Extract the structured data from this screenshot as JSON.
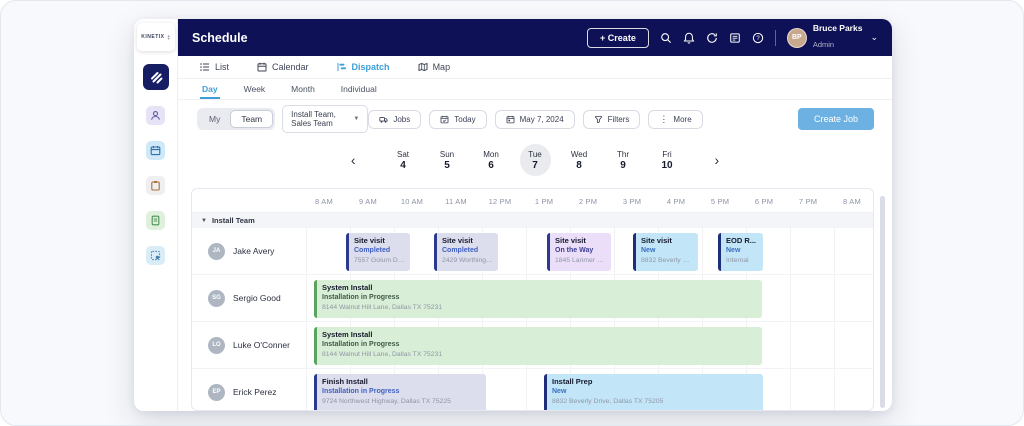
{
  "app": {
    "title": "Schedule",
    "logo": "kinetix"
  },
  "header": {
    "create": "+ Create",
    "user": {
      "name": "Bruce Parks",
      "role": "Admin",
      "initials": "BP"
    }
  },
  "tabs": {
    "list": "List",
    "calendar": "Calendar",
    "dispatch": "Dispatch",
    "map": "Map"
  },
  "subtabs": {
    "day": "Day",
    "week": "Week",
    "month": "Month",
    "individual": "Individual"
  },
  "toolbar": {
    "my": "My",
    "team": "Team",
    "team_filter": "Install Team, Sales Team",
    "jobs": "Jobs",
    "today": "Today",
    "date": "May 7, 2024",
    "filters": "Filters",
    "more": "More",
    "create_job": "Create Job"
  },
  "datenav": {
    "prev": "‹",
    "next": "›",
    "days": [
      {
        "label": "Sat",
        "num": "4"
      },
      {
        "label": "Sun",
        "num": "5"
      },
      {
        "label": "Mon",
        "num": "6"
      },
      {
        "label": "Tue",
        "num": "7"
      },
      {
        "label": "Wed",
        "num": "8"
      },
      {
        "label": "Thr",
        "num": "9"
      },
      {
        "label": "Fri",
        "num": "10"
      }
    ],
    "selected_day": "Tue 7"
  },
  "schedule": {
    "times": [
      "8 AM",
      "9 AM",
      "10 AM",
      "11 AM",
      "12 PM",
      "1 PM",
      "2 PM",
      "3 PM",
      "4 PM",
      "5 PM",
      "6 PM",
      "7 PM",
      "8 AM"
    ],
    "group": "Install Team",
    "rows": [
      {
        "name": "Jake Avery",
        "initials": "JA",
        "events": [
          {
            "title": "Site visit",
            "status": "Completed",
            "detail": "7557 Golum Dri..."
          },
          {
            "title": "Site visit",
            "status": "Completed",
            "detail": "2429 Worthingto..."
          },
          {
            "title": "Site visit",
            "status": "On the Way",
            "detail": "1845 Larimer Ro..."
          },
          {
            "title": "Site visit",
            "status": "New",
            "detail": "8832 Beverly Dri..."
          },
          {
            "title": "EOD R...",
            "status": "New",
            "detail": "Internal"
          }
        ]
      },
      {
        "name": "Sergio Good",
        "initials": "SG",
        "events": [
          {
            "title": "System Install",
            "status": "Installation in Progress",
            "detail": "8144 Walnut Hill Lane, Dallas TX 75231"
          }
        ]
      },
      {
        "name": "Luke O'Conner",
        "initials": "LO",
        "events": [
          {
            "title": "System Install",
            "status": "Installation in Progress",
            "detail": "8144 Walnut Hill Lane, Dallas TX 75231"
          }
        ]
      },
      {
        "name": "Erick Perez",
        "initials": "EP",
        "events": [
          {
            "title": "Finish Install",
            "status": "Installation in Progress",
            "detail": "9724 Northwest Highway, Dallas TX 75225"
          },
          {
            "title": "Install Prep",
            "status": "New",
            "detail": "8832 Beverly Drive, Dallas TX 75205"
          }
        ]
      }
    ]
  },
  "colors": {
    "navy_header": "#0e1156",
    "accent_blue": "#3d9fd8",
    "create_job_bg": "#6cb1e1",
    "event_gray": "#dcdded",
    "event_purple": "#eadef8",
    "event_blue": "#c2e6f7",
    "event_green": "#d8eed6",
    "stripe_navy": "#2b3a8f",
    "stripe_green": "#5aa35f",
    "scrollbar": "#d9dbe7"
  }
}
